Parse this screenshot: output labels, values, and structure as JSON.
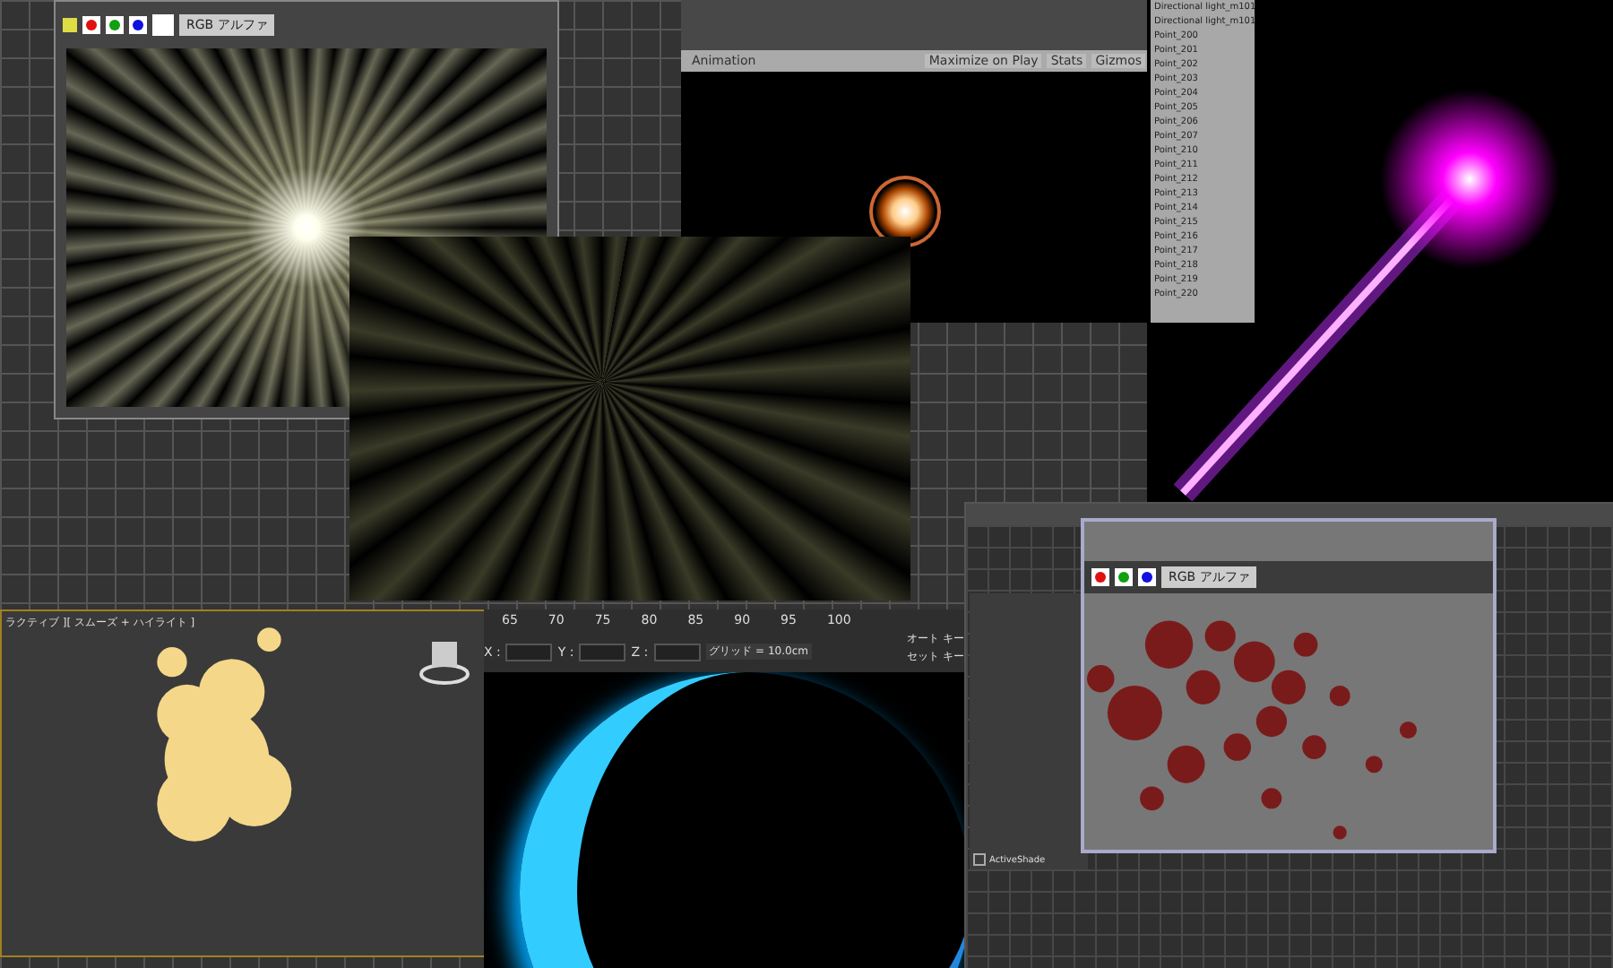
{
  "render_window": {
    "channel_dropdown": "RGB アルファ",
    "swatches": [
      {
        "color": "#e01010"
      },
      {
        "color": "#10a010"
      },
      {
        "color": "#1010e0"
      }
    ]
  },
  "unity_editor": {
    "tabs": [
      {
        "label": "Animation",
        "selected": false
      }
    ],
    "toolbar": [
      "Maximize on Play",
      "Stats",
      "Gizmos"
    ],
    "hierarchy": [
      "Directional light_m101",
      "Directional light_m101",
      "Point_200",
      "Point_201",
      "Point_202",
      "Point_203",
      "Point_204",
      "Point_205",
      "Point_206",
      "Point_207",
      "Point_210",
      "Point_211",
      "Point_212",
      "Point_213",
      "Point_214",
      "Point_215",
      "Point_216",
      "Point_217",
      "Point_218",
      "Point_219",
      "Point_220"
    ]
  },
  "viewport": {
    "label": "ラクティブ ][ スムーズ + ハイライト ]"
  },
  "timeline": {
    "ticks": [
      "65",
      "70",
      "75",
      "80",
      "85",
      "90",
      "95",
      "100"
    ],
    "coords": [
      "X :",
      "Y :",
      "Z :"
    ],
    "grid": "グリッド = 10.0cm",
    "buttons": [
      "オート キー",
      "セット キー"
    ]
  },
  "render_dialog": {
    "channel_dropdown": "RGB アルファ",
    "swatches": [
      {
        "color": "#e01010"
      },
      {
        "color": "#10a010"
      },
      {
        "color": "#1010e0"
      }
    ],
    "settings_options": [
      {
        "label": "ActiveShade",
        "checked": false
      }
    ]
  }
}
